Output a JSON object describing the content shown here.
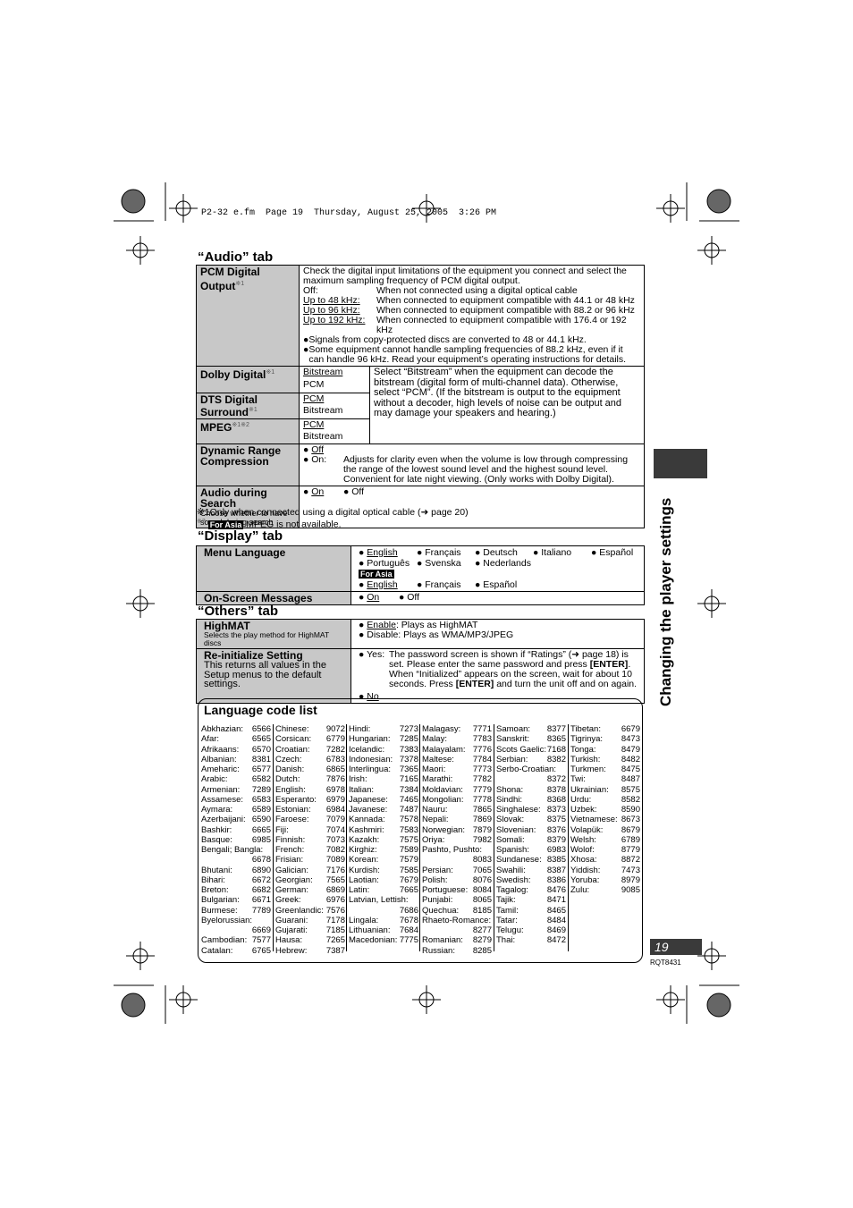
{
  "header_line": "P2-32 e.fm  Page 19  Thursday, August 25, 2005  3:26 PM",
  "side_title": "Changing the player settings",
  "page_number": "19",
  "doc_code": "RQT8431",
  "audio": {
    "title": "“Audio” tab",
    "pcm": {
      "label": "PCM Digital",
      "label2": "Output",
      "note": "※1",
      "intro": "Check the digital input limitations of the equipment you connect and select the maximum sampling frequency of PCM digital output.",
      "options": [
        {
          "k": "Off:",
          "v": "When not connected using a digital optical cable"
        },
        {
          "k": "Up to 48 kHz:",
          "v": "When connected to equipment compatible with 44.1 or 48 kHz"
        },
        {
          "k": "Up to 96 kHz:",
          "v": "When connected to equipment compatible with 88.2 or 96 kHz"
        },
        {
          "k": "Up to 192 kHz:",
          "v": "When connected to equipment compatible with 176.4 or 192 kHz"
        }
      ],
      "bullets": [
        "Signals from copy-protected discs are converted to 48 or 44.1 kHz.",
        "Some equipment cannot handle sampling frequencies of 88.2 kHz, even if it can handle 96 kHz. Read your equipment’s operating instructions for details."
      ]
    },
    "dolby": {
      "label": "Dolby Digital",
      "note": "※1",
      "opt1": "Bitstream",
      "opt2": "PCM"
    },
    "dts": {
      "label": "DTS Digital",
      "label2": "Surround",
      "note": "※1",
      "opt1": "PCM",
      "opt2": "Bitstream"
    },
    "mpeg": {
      "label": "MPEG",
      "note": "※1※2",
      "opt1": "PCM",
      "opt2": "Bitstream"
    },
    "bitstream_desc": "Select “Bitstream” when the equipment can decode the bitstream (digital form of multi-channel data). Otherwise, select “PCM”. (If the bitstream is output to the equipment without a decoder, high levels of noise can be output and may damage your speakers and hearing.)",
    "drc": {
      "label": "Dynamic Range Compression",
      "off": "Off",
      "on": "On:",
      "on_desc": "Adjusts for clarity even when the volume is low through compressing the range of the lowest sound level and the highest sound level. Convenient for late night viewing. (Only works with Dolby Digital)."
    },
    "search": {
      "label": "Audio during Search",
      "sub": "Choose whether to have sound during search",
      "on": "On",
      "off": "Off"
    },
    "footnote1": "※1Only when connected using a digital optical cable (➜ page 20)",
    "footnote2_mark": "※2",
    "footnote2_badge": "For Asia",
    "footnote2": "MPEG is not available."
  },
  "display": {
    "title": "“Display” tab",
    "menu_label": "Menu Language",
    "langs": [
      "English",
      "Français",
      "Deutsch",
      "Italiano",
      "Español",
      "Português",
      "Svenska",
      "Nederlands"
    ],
    "asia_badge": "For Asia",
    "asia_langs": [
      "English",
      "Français",
      "Español"
    ],
    "osm_label": "On-Screen Messages",
    "osm_on": "On",
    "osm_off": "Off"
  },
  "others": {
    "title": "“Others” tab",
    "highmat": {
      "label": "HighMAT",
      "sub": "Selects the play method for HighMAT discs",
      "enable": "Enable",
      "enable_desc": ": Plays as HighMAT",
      "disable": "Disable: Plays as WMA/MP3/JPEG"
    },
    "reinit": {
      "label": "Re-initialize Setting",
      "sub": "This returns all values in the Setup menus to the default settings.",
      "yes": "Yes:",
      "yes_desc1": "The password screen is shown if “Ratings” (➜ page 18) is set. Please enter the same password and press ",
      "enter": "[ENTER]",
      "yes_desc2": ". When “Initialized” appears on the screen, wait for about 10 seconds. Press ",
      "yes_desc3": " and turn the unit off and on again.",
      "no": "No"
    }
  },
  "language_codes": {
    "title": "Language code list",
    "columns": [
      [
        [
          "Abkhazian:",
          "6566"
        ],
        [
          "Afar:",
          "6565"
        ],
        [
          "Afrikaans:",
          "6570"
        ],
        [
          "Albanian:",
          "8381"
        ],
        [
          "Ameharic:",
          "6577"
        ],
        [
          "Arabic:",
          "6582"
        ],
        [
          "Armenian:",
          "7289"
        ],
        [
          "Assamese:",
          "6583"
        ],
        [
          "Aymara:",
          "6589"
        ],
        [
          "Azerbaijani:",
          "6590"
        ],
        [
          "Bashkir:",
          "6665"
        ],
        [
          "Basque:",
          "6985"
        ],
        [
          "Bengali; Bangla:",
          "6678"
        ],
        [
          "Bhutani:",
          "6890"
        ],
        [
          "Bihari:",
          "6672"
        ],
        [
          "Breton:",
          "6682"
        ],
        [
          "Bulgarian:",
          "6671"
        ],
        [
          "Burmese:",
          "7789"
        ],
        [
          "Byelorussian:",
          "6669"
        ],
        [
          "Cambodian:",
          "7577"
        ],
        [
          "Catalan:",
          "6765"
        ]
      ],
      [
        [
          "Chinese:",
          "9072"
        ],
        [
          "Corsican:",
          "6779"
        ],
        [
          "Croatian:",
          "7282"
        ],
        [
          "Czech:",
          "6783"
        ],
        [
          "Danish:",
          "6865"
        ],
        [
          "Dutch:",
          "7876"
        ],
        [
          "English:",
          "6978"
        ],
        [
          "Esperanto:",
          "6979"
        ],
        [
          "Estonian:",
          "6984"
        ],
        [
          "Faroese:",
          "7079"
        ],
        [
          "Fiji:",
          "7074"
        ],
        [
          "Finnish:",
          "7073"
        ],
        [
          "French:",
          "7082"
        ],
        [
          "Frisian:",
          "7089"
        ],
        [
          "Galician:",
          "7176"
        ],
        [
          "Georgian:",
          "7565"
        ],
        [
          "German:",
          "6869"
        ],
        [
          "Greek:",
          "6976"
        ],
        [
          "Greenlandic:",
          "7576"
        ],
        [
          "Guarani:",
          "7178"
        ],
        [
          "Gujarati:",
          "7185"
        ],
        [
          "Hausa:",
          "7265"
        ],
        [
          "Hebrew:",
          "7387"
        ]
      ],
      [
        [
          "Hindi:",
          "7273"
        ],
        [
          "Hungarian:",
          "7285"
        ],
        [
          "Icelandic:",
          "7383"
        ],
        [
          "Indonesian:",
          "7378"
        ],
        [
          "Interlingua:",
          "7365"
        ],
        [
          "Irish:",
          "7165"
        ],
        [
          "Italian:",
          "7384"
        ],
        [
          "Japanese:",
          "7465"
        ],
        [
          "Javanese:",
          "7487"
        ],
        [
          "Kannada:",
          "7578"
        ],
        [
          "Kashmiri:",
          "7583"
        ],
        [
          "Kazakh:",
          "7575"
        ],
        [
          "Kirghiz:",
          "7589"
        ],
        [
          "Korean:",
          "7579"
        ],
        [
          "Kurdish:",
          "7585"
        ],
        [
          "Laotian:",
          "7679"
        ],
        [
          "Latin:",
          "7665"
        ],
        [
          "Latvian, Lettish:",
          "7686"
        ],
        [
          "Lingala:",
          "7678"
        ],
        [
          "Lithuanian:",
          "7684"
        ],
        [
          "Macedonian:",
          "7775"
        ]
      ],
      [
        [
          "Malagasy:",
          "7771"
        ],
        [
          "Malay:",
          "7783"
        ],
        [
          "Malayalam:",
          "7776"
        ],
        [
          "Maltese:",
          "7784"
        ],
        [
          "Maori:",
          "7773"
        ],
        [
          "Marathi:",
          "7782"
        ],
        [
          "Moldavian:",
          "7779"
        ],
        [
          "Mongolian:",
          "7778"
        ],
        [
          "Nauru:",
          "7865"
        ],
        [
          "Nepali:",
          "7869"
        ],
        [
          "Norwegian:",
          "7879"
        ],
        [
          "Oriya:",
          "7982"
        ],
        [
          "Pashto, Pushto:",
          "8083"
        ],
        [
          "Persian:",
          "7065"
        ],
        [
          "Polish:",
          "8076"
        ],
        [
          "Portuguese:",
          "8084"
        ],
        [
          "Punjabi:",
          "8065"
        ],
        [
          "Quechua:",
          "8185"
        ],
        [
          "Rhaeto-Romance:",
          "8277"
        ],
        [
          "Romanian:",
          "8279"
        ],
        [
          "Russian:",
          "8285"
        ]
      ],
      [
        [
          "Samoan:",
          "8377"
        ],
        [
          "Sanskrit:",
          "8365"
        ],
        [
          "Scots Gaelic:",
          "7168"
        ],
        [
          "Serbian:",
          "8382"
        ],
        [
          "Serbo-Croatian:",
          "8372"
        ],
        [
          "Shona:",
          "8378"
        ],
        [
          "Sindhi:",
          "8368"
        ],
        [
          "Singhalese:",
          "8373"
        ],
        [
          "Slovak:",
          "8375"
        ],
        [
          "Slovenian:",
          "8376"
        ],
        [
          "Somali:",
          "8379"
        ],
        [
          "Spanish:",
          "6983"
        ],
        [
          "Sundanese:",
          "8385"
        ],
        [
          "Swahili:",
          "8387"
        ],
        [
          "Swedish:",
          "8386"
        ],
        [
          "Tagalog:",
          "8476"
        ],
        [
          "Tajik:",
          "8471"
        ],
        [
          "Tamil:",
          "8465"
        ],
        [
          "Tatar:",
          "8484"
        ],
        [
          "Telugu:",
          "8469"
        ],
        [
          "Thai:",
          "8472"
        ]
      ],
      [
        [
          "Tibetan:",
          "6679"
        ],
        [
          "Tigrinya:",
          "8473"
        ],
        [
          "Tonga:",
          "8479"
        ],
        [
          "Turkish:",
          "8482"
        ],
        [
          "Turkmen:",
          "8475"
        ],
        [
          "Twi:",
          "8487"
        ],
        [
          "Ukrainian:",
          "8575"
        ],
        [
          "Urdu:",
          "8582"
        ],
        [
          "Uzbek:",
          "8590"
        ],
        [
          "Vietnamese:",
          "8673"
        ],
        [
          "Volapük:",
          "8679"
        ],
        [
          "Welsh:",
          "6789"
        ],
        [
          "Wolof:",
          "8779"
        ],
        [
          "Xhosa:",
          "8872"
        ],
        [
          "Yiddish:",
          "7473"
        ],
        [
          "Yoruba:",
          "8979"
        ],
        [
          "Zulu:",
          "9085"
        ]
      ]
    ]
  }
}
